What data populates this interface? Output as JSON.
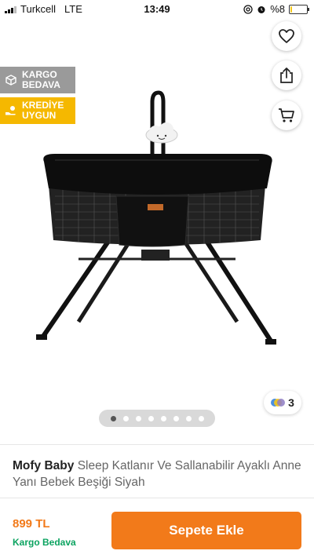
{
  "status_bar": {
    "carrier": "Turkcell",
    "network": "LTE",
    "time": "13:49",
    "battery_label": "%8",
    "battery_level": 0.08,
    "battery_color": "#f5c518"
  },
  "badges": {
    "cargo": {
      "line1": "KARGO",
      "line2": "BEDAVA",
      "color": "#9a9a9a"
    },
    "credit": {
      "line1": "KREDİYE",
      "line2": "UYGUN",
      "color": "#f5b800"
    }
  },
  "icons": {
    "back": "arrow-left-icon",
    "favorite": "heart-icon",
    "share": "share-icon",
    "cart": "cart-icon"
  },
  "gallery": {
    "image_count": 8,
    "active_index": 0,
    "color_variant_count": "3"
  },
  "product": {
    "brand": "Mofy Baby",
    "name": "Sleep Katlanır Ve Sallanabilir Ayaklı Anne Yanı Bebek Beşiği Siyah"
  },
  "purchase": {
    "price": "899 TL",
    "shipping": "Kargo Bedava",
    "add_to_cart": "Sepete Ekle"
  },
  "colors": {
    "accent": "#f27a1a",
    "shipping_green": "#0ba360"
  }
}
